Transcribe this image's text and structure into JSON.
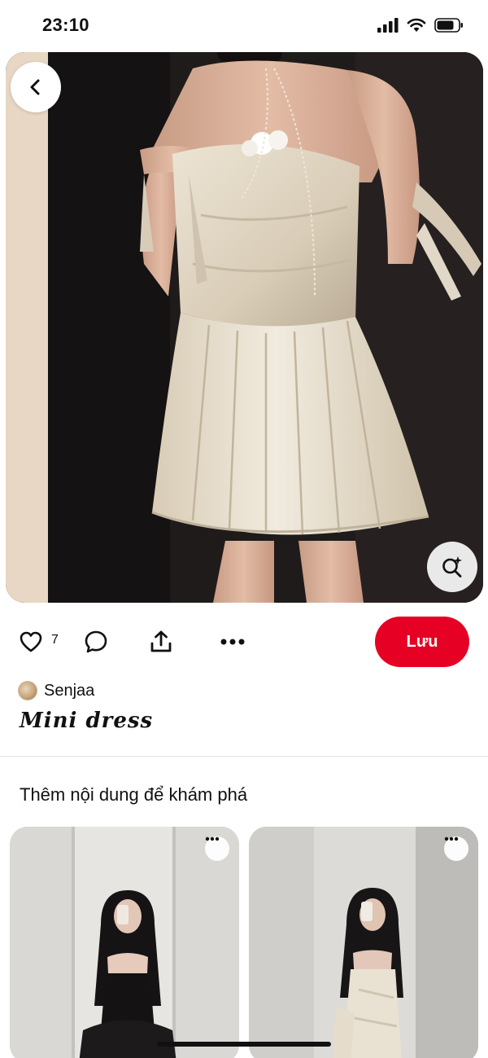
{
  "status_bar": {
    "time": "23:10"
  },
  "pin": {
    "like_count": "7",
    "save_label": "Lưu",
    "creator_name": "Senjaa",
    "title": "Mini dress"
  },
  "more_section": {
    "heading": "Thêm nội dung để khám phá"
  },
  "colors": {
    "save_button": "#e60023",
    "text": "#111111",
    "background": "#ffffff"
  },
  "icons": [
    "back-chevron-icon",
    "visual-search-icon",
    "heart-icon",
    "comment-icon",
    "share-icon",
    "more-dots-icon",
    "signal-icon",
    "wifi-icon",
    "battery-icon"
  ]
}
